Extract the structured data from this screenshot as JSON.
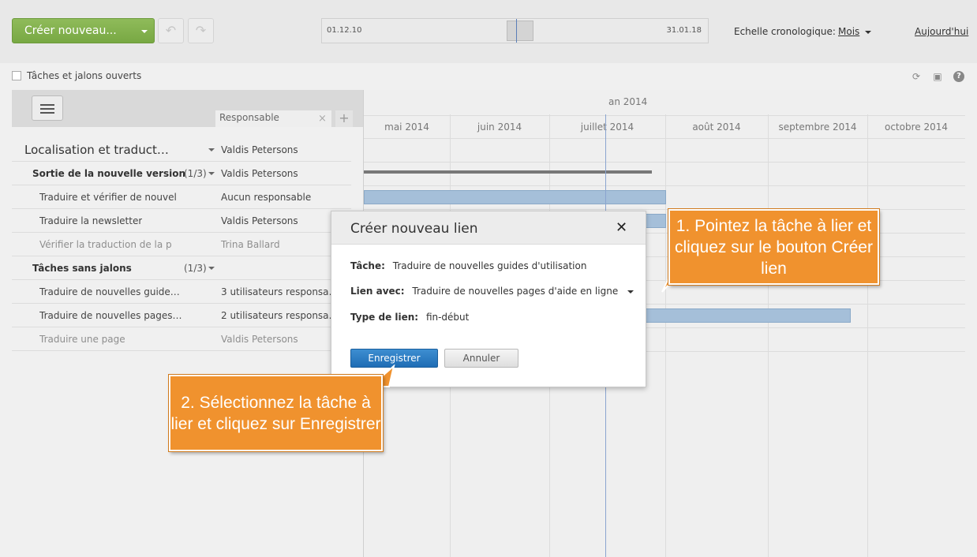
{
  "toolbar": {
    "create_label": "Créer nouveau...",
    "undo_icon": "undo-icon",
    "redo_icon": "redo-icon",
    "range_start": "01.12.10",
    "range_end": "31.01.18",
    "scale_label": "Echelle cronologique:",
    "scale_value": "Mois",
    "today_label": "Aujourd'hui"
  },
  "filter": {
    "checkbox_label": "Tâches et jalons ouverts",
    "icons": [
      "refresh-icon",
      "print-icon",
      "help-icon"
    ]
  },
  "tasklist": {
    "column_header": "Responsable",
    "rows": [
      {
        "name": "Localisation et traduct…",
        "count": "",
        "responsible": "Valdis Petersons",
        "type": "top"
      },
      {
        "name": "Sortie de la nouvelle version",
        "count": "(1/3)",
        "responsible": "Valdis Petersons",
        "type": "group"
      },
      {
        "name": "Traduire et vérifier de nouvel",
        "count": "",
        "responsible": "Aucun responsable",
        "type": "task"
      },
      {
        "name": "Traduire la newsletter",
        "count": "",
        "responsible": "Valdis Petersons",
        "type": "task"
      },
      {
        "name": "Vérifier la traduction de la p",
        "count": "",
        "responsible": "Trina Ballard",
        "type": "muted"
      },
      {
        "name": "Tâches sans jalons",
        "count": "(1/3)",
        "responsible": "",
        "type": "group"
      },
      {
        "name": "Traduire de nouvelles guide…",
        "count": "",
        "responsible": "3 utilisateurs responsa…",
        "type": "task"
      },
      {
        "name": "Traduire de nouvelles pages…",
        "count": "",
        "responsible": "2 utilisateurs responsa…",
        "type": "task"
      },
      {
        "name": "Traduire une page",
        "count": "",
        "responsible": "Valdis Petersons",
        "type": "muted"
      }
    ]
  },
  "gantt": {
    "year": "an 2014",
    "months": [
      "mai 2014",
      "juin 2014",
      "juillet 2014",
      "août 2014",
      "septembre 2014",
      "octobre 2014"
    ]
  },
  "dialog": {
    "title": "Créer nouveau lien",
    "task_label": "Tâche:",
    "task_value": "Traduire de nouvelles guides d'utilisation",
    "link_label": "Lien avec:",
    "link_value": "Traduire de nouvelles pages d'aide en ligne",
    "type_label": "Type de lien:",
    "type_value": "fin-début",
    "save_label": "Enregistrer",
    "cancel_label": "Annuler"
  },
  "callouts": {
    "step1": "1. Pointez la tâche à lier et cliquez sur le bouton Créer lien",
    "step2": "2. Sélectionnez la tâche à lier et cliquez sur Enregistrer"
  },
  "colors": {
    "accent_green": "#7aab45",
    "save_blue": "#2a7cc4",
    "callout_orange": "#f0922e",
    "bar_blue": "#a5bfd9"
  }
}
